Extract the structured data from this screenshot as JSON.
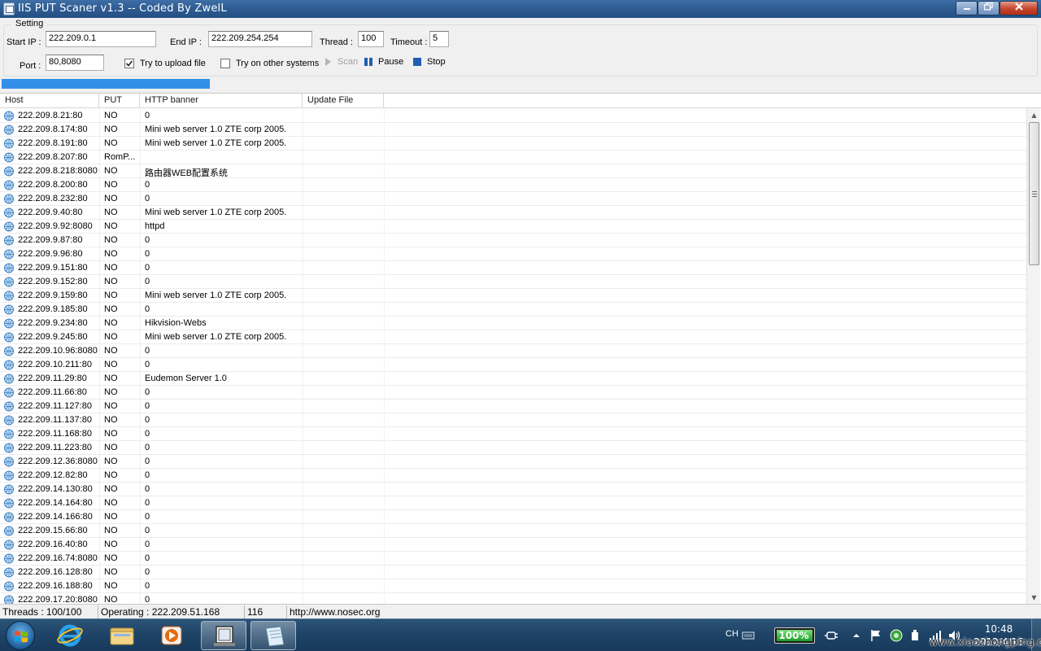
{
  "window": {
    "title": "IIS PUT Scaner v1.3 -- Coded By ZwelL"
  },
  "settings": {
    "group_label": "Setting",
    "start_ip_label": "Start IP :",
    "start_ip_value": "222.209.0.1",
    "end_ip_label": "End IP :",
    "end_ip_value": "222.209.254.254",
    "thread_label": "Thread :",
    "thread_value": "100",
    "timeout_label": "Timeout :",
    "timeout_value": "5",
    "port_label": "Port :",
    "port_value": "80,8080",
    "upload_label": "Try to upload file",
    "upload_checked": true,
    "other_systems_label": "Try on other systems",
    "other_systems_checked": false,
    "scan_label": "Scan",
    "pause_label": "Pause",
    "stop_label": "Stop"
  },
  "progress": {
    "fraction": 0.2
  },
  "list": {
    "columns": [
      "Host",
      "PUT",
      "HTTP banner",
      "Update File"
    ],
    "rows": [
      [
        "222.209.8.21:80",
        "NO",
        "0",
        ""
      ],
      [
        "222.209.8.174:80",
        "NO",
        "Mini web server 1.0 ZTE corp 2005.",
        ""
      ],
      [
        "222.209.8.191:80",
        "NO",
        "Mini web server 1.0 ZTE corp 2005.",
        ""
      ],
      [
        "222.209.8.207:80",
        "RomP...",
        "",
        ""
      ],
      [
        "222.209.8.218:8080",
        "NO",
        "路由器WEB配置系统",
        ""
      ],
      [
        "222.209.8.200:80",
        "NO",
        "0",
        ""
      ],
      [
        "222.209.8.232:80",
        "NO",
        "0",
        ""
      ],
      [
        "222.209.9.40:80",
        "NO",
        "Mini web server 1.0 ZTE corp 2005.",
        ""
      ],
      [
        "222.209.9.92:8080",
        "NO",
        "httpd",
        ""
      ],
      [
        "222.209.9.87:80",
        "NO",
        "0",
        ""
      ],
      [
        "222.209.9.96:80",
        "NO",
        "0",
        ""
      ],
      [
        "222.209.9.151:80",
        "NO",
        "0",
        ""
      ],
      [
        "222.209.9.152:80",
        "NO",
        "0",
        ""
      ],
      [
        "222.209.9.159:80",
        "NO",
        "Mini web server 1.0 ZTE corp 2005.",
        ""
      ],
      [
        "222.209.9.185:80",
        "NO",
        "0",
        ""
      ],
      [
        "222.209.9.234:80",
        "NO",
        "Hikvision-Webs",
        ""
      ],
      [
        "222.209.9.245:80",
        "NO",
        "Mini web server 1.0 ZTE corp 2005.",
        ""
      ],
      [
        "222.209.10.96:8080",
        "NO",
        "0",
        ""
      ],
      [
        "222.209.10.211:80",
        "NO",
        "0",
        ""
      ],
      [
        "222.209.11.29:80",
        "NO",
        "Eudemon Server 1.0",
        ""
      ],
      [
        "222.209.11.66:80",
        "NO",
        "0",
        ""
      ],
      [
        "222.209.11.127:80",
        "NO",
        "0",
        ""
      ],
      [
        "222.209.11.137:80",
        "NO",
        "0",
        ""
      ],
      [
        "222.209.11.168:80",
        "NO",
        "0",
        ""
      ],
      [
        "222.209.11.223:80",
        "NO",
        "0",
        ""
      ],
      [
        "222.209.12.36:8080",
        "NO",
        "0",
        ""
      ],
      [
        "222.209.12.82:80",
        "NO",
        "0",
        ""
      ],
      [
        "222.209.14.130:80",
        "NO",
        "0",
        ""
      ],
      [
        "222.209.14.164:80",
        "NO",
        "0",
        ""
      ],
      [
        "222.209.14.166:80",
        "NO",
        "0",
        ""
      ],
      [
        "222.209.15.66:80",
        "NO",
        "0",
        ""
      ],
      [
        "222.209.16.40:80",
        "NO",
        "0",
        ""
      ],
      [
        "222.209.16.74:8080",
        "NO",
        "0",
        ""
      ],
      [
        "222.209.16.128:80",
        "NO",
        "0",
        ""
      ],
      [
        "222.209.16.188:80",
        "NO",
        "0",
        ""
      ],
      [
        "222.209.17.20:8080",
        "NO",
        "0",
        ""
      ]
    ]
  },
  "status": {
    "threads": "Threads : 100/100",
    "operating": "Operating : 222.209.51.168",
    "count": "116",
    "url": "http://www.nosec.org"
  },
  "taskbar": {
    "language": "CH",
    "battery": "100%",
    "time": "10:48",
    "date": "2012/4/15",
    "watermark": "www.xiaozhongping.org"
  },
  "colors": {
    "progress": "#3390e8",
    "titlebar": "#2f5d94",
    "taskbar": "#1f4467"
  }
}
